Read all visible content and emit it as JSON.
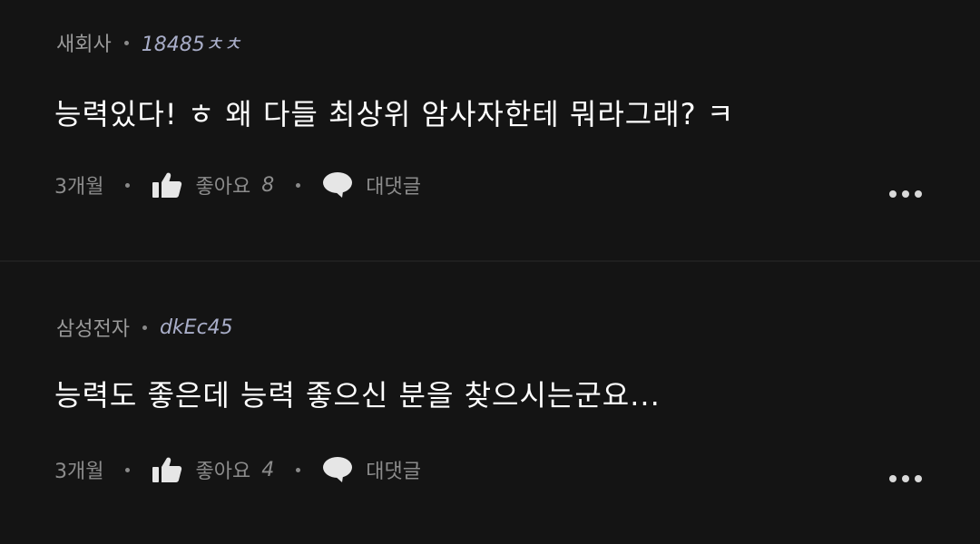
{
  "comments": [
    {
      "company": "새회사",
      "handle": "18485ㅊㅊ",
      "text": "능력있다! ㅎ 왜 다들 최상위 암사자한테 뭐라그래? ㅋ",
      "time": "3개월",
      "like_label": "좋아요",
      "like_count": "8",
      "reply_label": "대댓글"
    },
    {
      "company": "삼성전자",
      "handle": "dkEc45",
      "text": "능력도 좋은데 능력 좋으신 분을 찾으시는군요...",
      "time": "3개월",
      "like_label": "좋아요",
      "like_count": "4",
      "reply_label": "대댓글"
    }
  ],
  "icons": {
    "like": "thumbs-up-icon",
    "reply": "speech-bubble-icon",
    "more": "more-horizontal-icon"
  },
  "colors": {
    "background": "#141414",
    "text_primary": "#ffffff",
    "text_muted": "#8c8c8c",
    "handle": "#a9aec9"
  }
}
